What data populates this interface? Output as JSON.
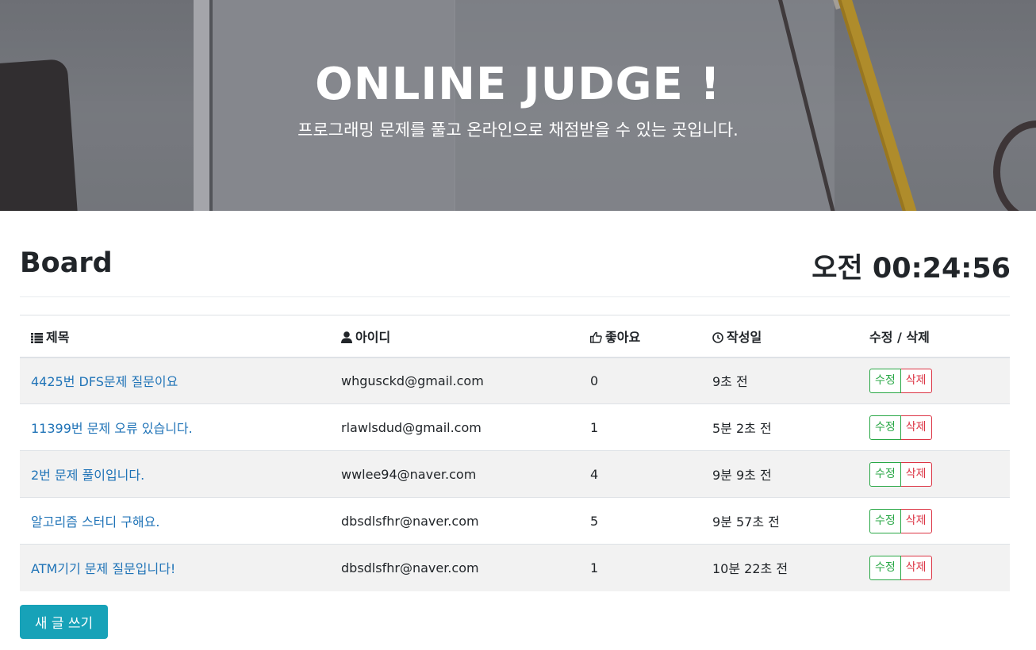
{
  "hero": {
    "title": "ONLINE JUDGE !",
    "subtitle": "프로그래밍 문제를 풀고 온라인으로 채점받을 수 있는 곳입니다."
  },
  "board": {
    "title": "Board",
    "clock": "오전 00:24:56"
  },
  "table": {
    "headers": {
      "title": "제목",
      "author": "아이디",
      "likes": "좋아요",
      "date": "작성일",
      "actions": "수정 / 삭제"
    },
    "header_icons": {
      "title": "list-icon",
      "author": "user-icon",
      "likes": "thumbs-up-icon",
      "date": "clock-icon"
    },
    "rows": [
      {
        "title": "4425번 DFS문제 질문이요",
        "author": "whgusckd@gmail.com",
        "likes": "0",
        "date": "9초 전"
      },
      {
        "title": "11399번 문제 오류 있습니다.",
        "author": "rlawlsdud@gmail.com",
        "likes": "1",
        "date": "5분 2초 전"
      },
      {
        "title": "2번 문제 풀이입니다.",
        "author": "wwlee94@naver.com",
        "likes": "4",
        "date": "9분 9초 전"
      },
      {
        "title": "알고리즘 스터디 구해요.",
        "author": "dbsdlsfhr@naver.com",
        "likes": "5",
        "date": "9분 57초 전"
      },
      {
        "title": "ATM기기 문제 질문입니다!",
        "author": "dbsdlsfhr@naver.com",
        "likes": "1",
        "date": "10분 22초 전"
      }
    ],
    "edit_label": "수정",
    "delete_label": "삭제"
  },
  "new_post_label": "새 글 쓰기",
  "colors": {
    "link": "#1f73b7",
    "edit": "#28a745",
    "delete": "#dc3545",
    "primary_button": "#17a2b8",
    "striped_row": "#f2f2f2"
  }
}
